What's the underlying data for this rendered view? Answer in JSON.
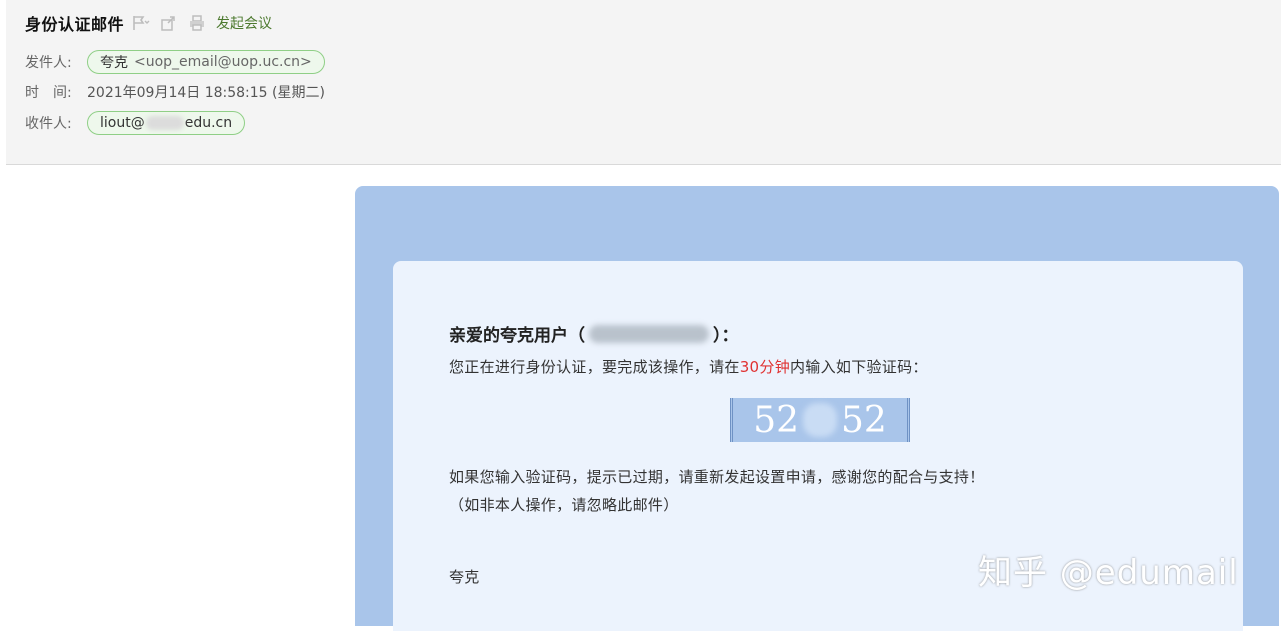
{
  "email": {
    "subject": "身份认证邮件",
    "toolbar": {
      "flag_icon": "flag-icon",
      "forward_icon": "forward-icon",
      "print_icon": "print-icon",
      "meeting_label": "发起会议"
    },
    "sender": {
      "label": "发件人:",
      "name": "夸克",
      "address": "<uop_email@uop.uc.cn>"
    },
    "time": {
      "label": "时　间:",
      "value": "2021年09月14日 18:58:15 (星期二)"
    },
    "recipient": {
      "label": "收件人:",
      "prefix": "liout@",
      "suffix": "edu.cn"
    }
  },
  "body": {
    "greeting_prefix": "亲爱的夸克用户（",
    "greeting_suffix": "）：",
    "instruction_before": "您正在进行身份认证，要完成该操作，请在",
    "instruction_highlight": "30分钟",
    "instruction_after": "内输入如下验证码：",
    "code_part1": "52",
    "code_part2": "52",
    "expired_note": "如果您输入验证码，提示已过期，请重新发起设置申请，感谢您的配合与支持！",
    "not_me_note": "（如非本人操作，请忽略此邮件）",
    "signature": "夸克"
  },
  "watermark": "知乎 @edumail",
  "colors": {
    "frame": "#a9c5ea",
    "card": "#ecf3fd",
    "highlight": "#e03232",
    "chip_border": "#8fcf86"
  }
}
